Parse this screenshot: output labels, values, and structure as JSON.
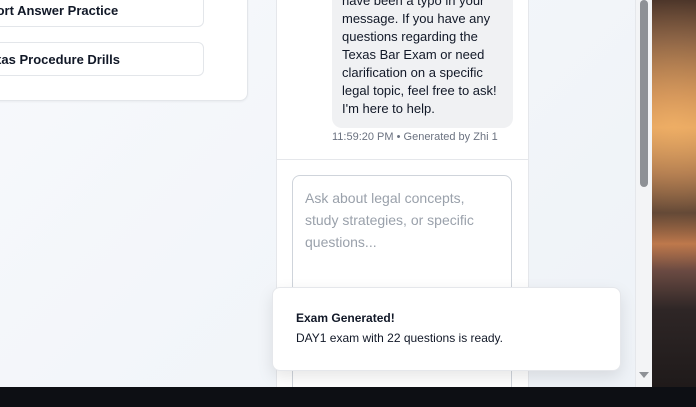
{
  "practice": {
    "items": [
      {
        "label": "Short Answer Practice"
      },
      {
        "label": "Texas Procedure Drills"
      }
    ]
  },
  "chat": {
    "message_lines": [
      "have been a typo in your",
      "message. If you have any",
      "questions regarding the",
      "Texas Bar Exam or need",
      "clarification on a specific",
      "legal topic, feel free to ask!",
      "I'm here to help."
    ],
    "meta": "11:59:20 PM • Generated by Zhi 1",
    "input_placeholder": "Ask about legal concepts, study strategies, or specific questions..."
  },
  "toast": {
    "title": "Exam Generated!",
    "description": "DAY1 exam with 22 questions is ready."
  },
  "icons": {
    "scroll_down": "chevron-down-icon"
  }
}
